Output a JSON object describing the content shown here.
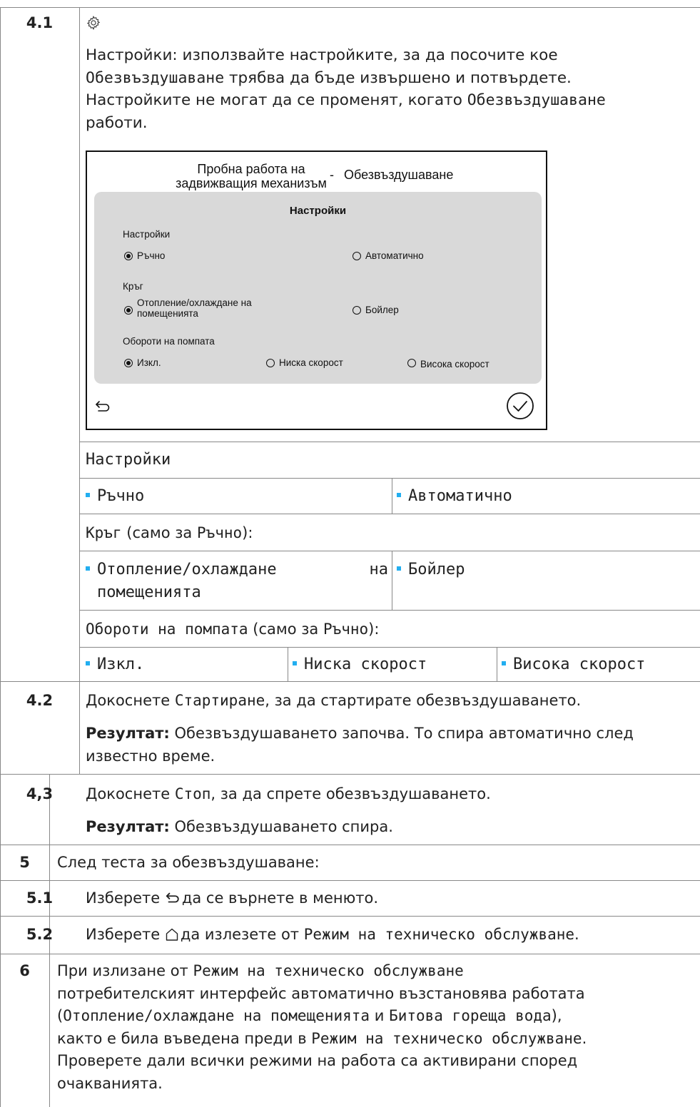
{
  "rows": {
    "r41": {
      "num": "4.1",
      "icon": "gear-icon",
      "desc": [
        [
          {
            "t": "Настройки: използвайте настройките, за да посочите кое"
          }
        ],
        [
          {
            "t": "Обезвъздушаване",
            "m": 1
          },
          {
            "t": " трябва да бъде извършено и потвърдете."
          }
        ],
        [
          {
            "t": "Настройките не могат да се променят, когато "
          },
          {
            "t": "Обезвъздушаване",
            "m": 1
          }
        ],
        [
          {
            "t": "работи."
          }
        ]
      ]
    },
    "r42": {
      "num": "4.2",
      "line1": [
        {
          "t": "Докоснете "
        },
        {
          "t": "Стартиране",
          "m": 1
        },
        {
          "t": ", за да стартирате обезвъздушаването."
        }
      ],
      "result_label": "Резултат:",
      "result_text1": " Обезвъздушаването започва. То спира автоматично след",
      "result_text2": "известно време."
    },
    "r43": {
      "num": "4,3",
      "line1": [
        {
          "t": "Докоснете "
        },
        {
          "t": "Стоп",
          "m": 1
        },
        {
          "t": ", за да спрете обезвъздушаването."
        }
      ],
      "result_label": "Резултат:",
      "result_text": " Обезвъздушаването спира."
    },
    "r5": {
      "num": "5",
      "text": "След теста за обезвъздушаване:"
    },
    "r51": {
      "num": "5.1",
      "pre": "Изберете ",
      "icon": "back-arrow-icon",
      "post": "да се върнете в менюто."
    },
    "r52": {
      "num": "5.2",
      "pre": "Изберете ",
      "icon": "home-icon",
      "post": "да излезете от ",
      "mode": "Режим на техническо обслужване",
      "end": "."
    },
    "r6": {
      "num": "6",
      "desc": [
        [
          {
            "t": "При излизане от "
          },
          {
            "t": "Режим на техническо обслужване",
            "m": 1
          }
        ],
        [
          {
            "t": "потребителският интерфейс автоматично възстановява работата"
          }
        ],
        [
          {
            "t": "("
          },
          {
            "t": "Отопление/охлаждане на помещенията",
            "m": 1
          },
          {
            "t": " и "
          },
          {
            "t": "Битова гореща вода",
            "m": 1
          },
          {
            "t": "),"
          }
        ],
        [
          {
            "t": "както е била въведена преди в "
          },
          {
            "t": "Режим на техническо обслужване",
            "m": 1
          },
          {
            "t": "."
          }
        ],
        [
          {
            "t": "Проверете дали всички режими на работа са активирани според"
          }
        ],
        [
          {
            "t": "очакванията."
          }
        ]
      ]
    }
  },
  "screen": {
    "title_left_1": "Пробна работа на",
    "title_left_2": "задвижващия механизъм",
    "title_dash": "-",
    "title_right": "Обезвъздушаване",
    "panel_title": "Настройки",
    "g1_label": "Настройки",
    "g1_opt1": "Ръчно",
    "g1_opt2": "Автоматично",
    "g2_label": "Кръг",
    "g2_opt1_l1": "Отопление/охлаждане на",
    "g2_opt1_l2": "помещенията",
    "g2_opt2": "Бойлер",
    "g3_label": "Обороти на помпата",
    "g3_opt1": "Изкл.",
    "g3_opt2": "Ниска скорост",
    "g3_opt3": "Висока скорост",
    "back_icon": "back-arrow-icon",
    "confirm_icon": "check-circle-icon"
  },
  "settings_table": {
    "header": "Настройки",
    "row1": [
      "Ръчно",
      "Автоматично"
    ],
    "circuit_label": "Кръг",
    "circuit_note_pre": " (само за ",
    "circuit_note_mode": "Ръчно",
    "circuit_note_post": "):",
    "row2_a_1": "Отопление/охлаждане",
    "row2_a_2": "на",
    "row2_a_3": "помещенията",
    "row2_b": "Бойлер",
    "pump_label": "Обороти на помпата",
    "pump_note_pre": " (само за ",
    "pump_note_mode": "Ръчно",
    "pump_note_post": "):",
    "row3": [
      "Изкл.",
      "Ниска скорост",
      "Висока скорост"
    ]
  },
  "colors": {
    "bullet": "#22aef0",
    "lines": "#888888",
    "panel": "#d9d9d9"
  }
}
